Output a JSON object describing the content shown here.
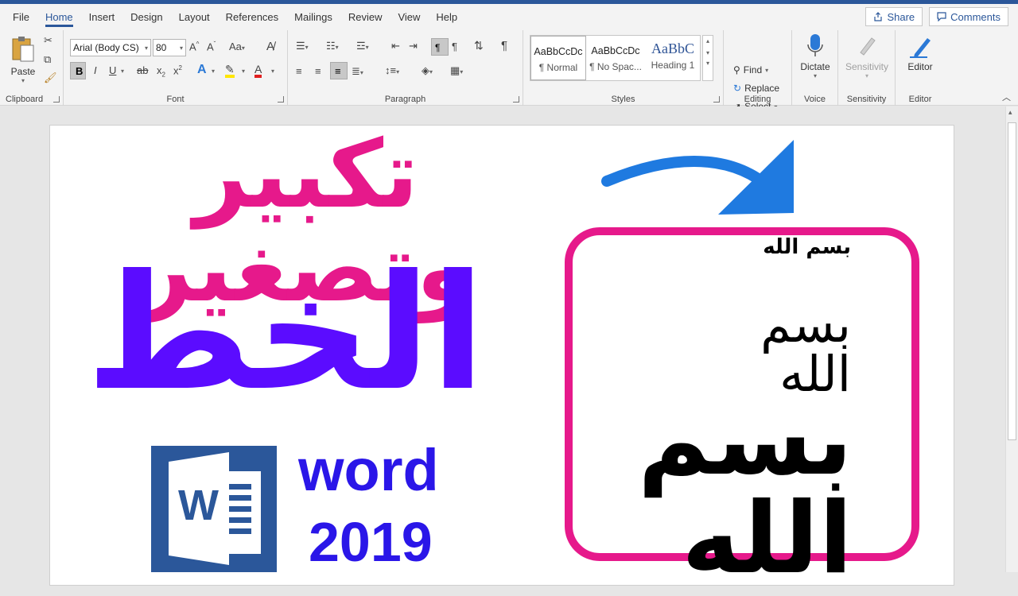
{
  "menu": {
    "items": [
      "File",
      "Home",
      "Insert",
      "Design",
      "Layout",
      "References",
      "Mailings",
      "Review",
      "View",
      "Help"
    ],
    "active": "Home",
    "share_label": "Share",
    "comments_label": "Comments"
  },
  "ribbon": {
    "clipboard": {
      "label": "Clipboard",
      "paste_label": "Paste"
    },
    "font": {
      "label": "Font",
      "font_name": "Arial (Body CS)",
      "font_size": "80",
      "case_label": "Aa"
    },
    "paragraph": {
      "label": "Paragraph"
    },
    "styles": {
      "label": "Styles",
      "items": [
        {
          "sample": "AaBbCcDc",
          "name": "¶ Normal"
        },
        {
          "sample": "AaBbCcDc",
          "name": "¶ No Spac..."
        },
        {
          "sample": "AaBbC",
          "name": "Heading 1"
        }
      ]
    },
    "editing": {
      "label": "Editing",
      "find_label": "Find",
      "replace_label": "Replace",
      "select_label": "Select"
    },
    "voice": {
      "label": "Voice",
      "dictate_label": "Dictate"
    },
    "sensitivity": {
      "label": "Sensitivity",
      "button_label": "Sensitivity"
    },
    "editor": {
      "label": "Editor",
      "button_label": "Editor"
    }
  },
  "thumbnail": {
    "title_line1": "تكبير وتصغير",
    "title_line2": "الخط",
    "word_text": "word",
    "year_text": "2019",
    "word_logo_letter": "W",
    "samples": [
      "بسم الله",
      "بسم الله",
      "بسم الله"
    ],
    "colors": {
      "pink": "#e6198b",
      "purple": "#5b0cff",
      "blue": "#2a16e8",
      "arrow": "#1f7ae0",
      "word_blue": "#2b579a"
    }
  }
}
